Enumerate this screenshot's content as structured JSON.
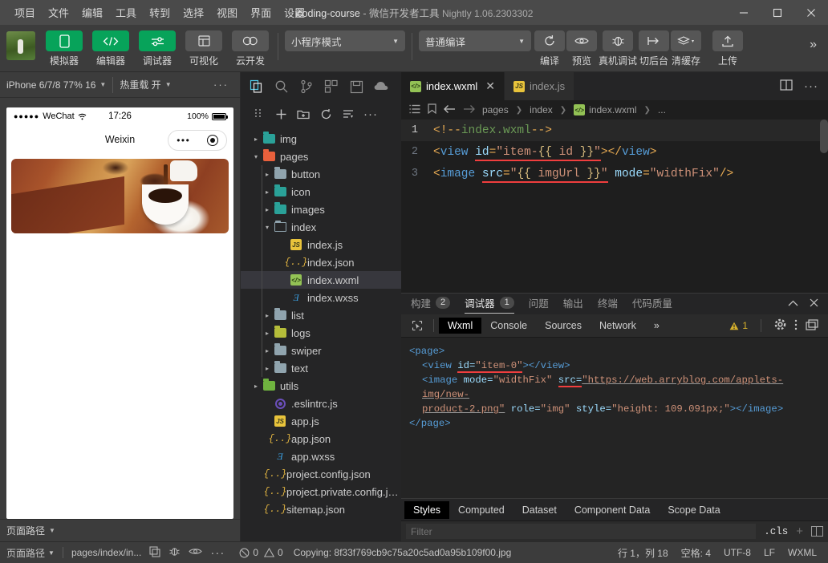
{
  "titlebar": {
    "menu": [
      "项目",
      "文件",
      "编辑",
      "工具",
      "转到",
      "选择",
      "视图",
      "界面",
      "设置",
      "..."
    ],
    "project": "icoding-course",
    "dash": "-",
    "app_name": "微信开发者工具",
    "version": "Nightly 1.06.2303302",
    "minimize": "—",
    "maximize": "▢",
    "close": "✕"
  },
  "toolbar": {
    "buttons": [
      {
        "label": "模拟器",
        "icon": "phone-icon",
        "style": "green"
      },
      {
        "label": "编辑器",
        "icon": "code-icon",
        "style": "green"
      },
      {
        "label": "调试器",
        "icon": "sliders-icon",
        "style": "green"
      },
      {
        "label": "可视化",
        "icon": "layout-icon",
        "style": "grey"
      },
      {
        "label": "云开发",
        "icon": "cloud-icon",
        "style": "grey"
      }
    ],
    "mode_select": "小程序模式",
    "compile_select": "普通编译",
    "actions": [
      {
        "label": "编译",
        "icon": "refresh-icon"
      },
      {
        "label": "预览",
        "icon": "eye-icon"
      },
      {
        "label": "真机调试",
        "icon": "bug-icon"
      },
      {
        "label": "切后台",
        "icon": "background-icon"
      },
      {
        "label": "清缓存",
        "icon": "layers-icon"
      },
      {
        "label": "上传",
        "icon": "upload-icon"
      }
    ],
    "more": "»"
  },
  "simulator": {
    "device": "iPhone 6/7/8 77% 16",
    "hotreload": "热重载 开",
    "more": "···",
    "phone": {
      "carrier": "WeChat",
      "signal_dots": "●●●●●",
      "wifi": "≈",
      "time": "17:26",
      "battery_pct": "100%",
      "nav_title": "Weixin",
      "capsule_dots": "•••"
    },
    "footer": {
      "path_label": "页面路径",
      "path": "pages/index/in...",
      "icons": [
        "copy-icon",
        "bug-icon",
        "eye-icon",
        "more-icon"
      ]
    }
  },
  "explorer": {
    "top_icons": [
      "files-icon",
      "search-icon",
      "source-control-icon",
      "extensions-icon",
      "save-icon",
      "cloud-debug-icon"
    ],
    "action_icons": [
      "collapse-branch-icon",
      "new-file-icon",
      "new-folder-icon",
      "refresh-icon",
      "collapse-all-icon",
      "more-icon"
    ],
    "tree": [
      {
        "name": "img",
        "type": "folder",
        "color": "teal",
        "indent": 0,
        "arrow": "▸"
      },
      {
        "name": "pages",
        "type": "folder",
        "color": "orange",
        "indent": 0,
        "arrow": "▾"
      },
      {
        "name": "button",
        "type": "folder",
        "color": "grey",
        "indent": 1,
        "arrow": "▸"
      },
      {
        "name": "icon",
        "type": "folder",
        "color": "teal",
        "indent": 1,
        "arrow": "▸"
      },
      {
        "name": "images",
        "type": "folder",
        "color": "teal",
        "indent": 1,
        "arrow": "▸"
      },
      {
        "name": "index",
        "type": "folder-open",
        "color": "grey",
        "indent": 1,
        "arrow": "▾"
      },
      {
        "name": "index.js",
        "type": "js",
        "indent": 2,
        "arrow": ""
      },
      {
        "name": "index.json",
        "type": "json",
        "indent": 2,
        "arrow": ""
      },
      {
        "name": "index.wxml",
        "type": "wxml",
        "indent": 2,
        "arrow": "",
        "selected": true
      },
      {
        "name": "index.wxss",
        "type": "wxss",
        "indent": 2,
        "arrow": ""
      },
      {
        "name": "list",
        "type": "folder",
        "color": "grey",
        "indent": 1,
        "arrow": "▸"
      },
      {
        "name": "logs",
        "type": "folder",
        "color": "olive",
        "indent": 1,
        "arrow": "▸"
      },
      {
        "name": "swiper",
        "type": "folder",
        "color": "grey",
        "indent": 1,
        "arrow": "▸"
      },
      {
        "name": "text",
        "type": "folder",
        "color": "grey",
        "indent": 1,
        "arrow": "▸"
      },
      {
        "name": "utils",
        "type": "folder",
        "color": "green",
        "indent": 0,
        "arrow": "▸"
      },
      {
        "name": ".eslintrc.js",
        "type": "eslint",
        "indent": 1,
        "arrow": ""
      },
      {
        "name": "app.js",
        "type": "js",
        "indent": 1,
        "arrow": ""
      },
      {
        "name": "app.json",
        "type": "json",
        "indent": 1,
        "arrow": ""
      },
      {
        "name": "app.wxss",
        "type": "wxss",
        "indent": 1,
        "arrow": ""
      },
      {
        "name": "project.config.json",
        "type": "json",
        "indent": 1,
        "arrow": ""
      },
      {
        "name": "project.private.config.js...",
        "type": "json",
        "indent": 1,
        "arrow": ""
      },
      {
        "name": "sitemap.json",
        "type": "json",
        "indent": 1,
        "arrow": ""
      }
    ]
  },
  "editor": {
    "tabs": [
      {
        "label": "index.wxml",
        "icon": "wxml-icon",
        "active": true,
        "close": "✕"
      },
      {
        "label": "index.js",
        "icon": "js-icon",
        "active": false
      }
    ],
    "tab_actions": [
      "split-editor-icon",
      "more-icon"
    ],
    "breadcrumb": {
      "icons": [
        "outline-icon",
        "bookmark-icon",
        "back-icon",
        "forward-icon"
      ],
      "parts": [
        "pages",
        "index",
        "index.wxml",
        "..."
      ]
    },
    "lines": [
      {
        "num": "1",
        "current": true
      },
      {
        "num": "2",
        "current": false
      },
      {
        "num": "3",
        "current": false
      }
    ],
    "code": {
      "l1": "<!--index.wxml-->",
      "l2": "<view id=\"item-{{ id }}\"></view>",
      "l3": "<image src=\"{{ imgUrl }}\" mode=\"widthFix\"/>"
    }
  },
  "debugger": {
    "panel_tabs": [
      {
        "label": "构建",
        "badge": "2",
        "active": false
      },
      {
        "label": "调试器",
        "badge": "1",
        "active": true
      },
      {
        "label": "问题",
        "badge": "",
        "active": false
      },
      {
        "label": "输出",
        "badge": "",
        "active": false
      },
      {
        "label": "终端",
        "badge": "",
        "active": false
      },
      {
        "label": "代码质量",
        "badge": "",
        "active": false
      }
    ],
    "panel_actions": [
      "collapse-icon",
      "close-icon"
    ],
    "devtools_tabs": [
      "Wxml",
      "Console",
      "Sources",
      "Network"
    ],
    "devtools_more": "»",
    "warn_count": "1",
    "devtools_right_icons": [
      "warning-icon",
      "settings-gear-icon",
      "kebab-menu-icon",
      "dock-icon"
    ],
    "dom": {
      "l1": "<page>",
      "l2_a": "<view ",
      "l2_attr": "id=",
      "l2_val": "\"item-0\"",
      "l2_close": "></view>",
      "l3_a": "<image ",
      "l3_mode": "mode=",
      "l3_modeval": "\"widthFix\"",
      "l3_src": "src=",
      "l3_url": "\"https://web.arryblog.com/applets-img/new-",
      "l4_url": "product-2.png\"",
      "l4_role": "role=",
      "l4_roleval": "\"img\"",
      "l4_style": "style=",
      "l4_styleval": "\"height: 109.091px;\"",
      "l4_close": "></image>",
      "l5": "</page>"
    },
    "styles_tabs": [
      "Styles",
      "Computed",
      "Dataset",
      "Component Data",
      "Scope Data"
    ],
    "filter_placeholder": "Filter",
    "cls_label": ".cls",
    "plus": "+"
  },
  "statusbar": {
    "page_path_label": "页面路径",
    "page_path": "pages/index/in...",
    "icons": [
      "copy-icon",
      "bug-icon",
      "eye-icon",
      "more-icon"
    ],
    "errors": "0",
    "warnings": "0",
    "message": "Copying: 8f33f769cb9c75a20c5ad0a95b109f00.jpg",
    "cursor": "行 1，列 18",
    "spaces": "空格: 4",
    "encoding": "UTF-8",
    "eol": "LF",
    "language": "WXML"
  },
  "colors": {
    "accent_green": "#07a35a",
    "titlebar_bg": "#4a4a4a",
    "editor_bg": "#1e1e1e",
    "sidebar_bg": "#252526"
  }
}
